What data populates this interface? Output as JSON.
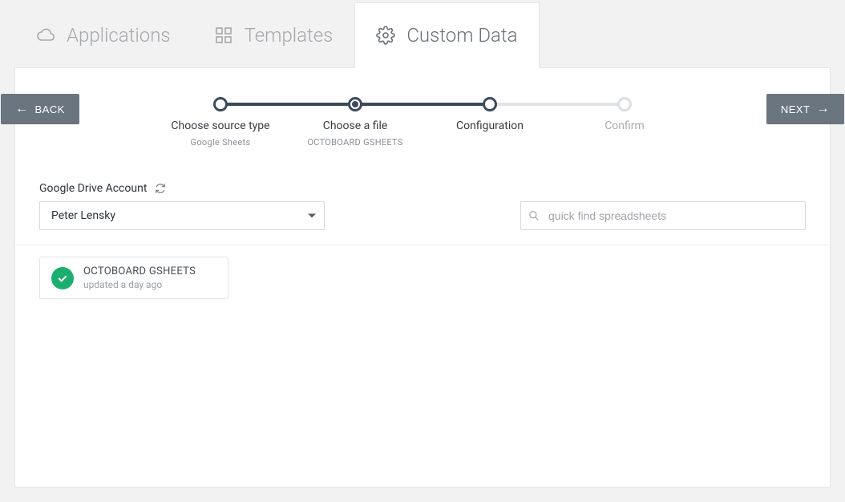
{
  "tabs": {
    "applications": "Applications",
    "templates": "Templates",
    "custom_data": "Custom Data"
  },
  "nav": {
    "back": "BACK",
    "next": "NEXT"
  },
  "stepper": {
    "steps": [
      {
        "title": "Choose source type",
        "sub": "Google Sheets"
      },
      {
        "title": "Choose a file",
        "sub": "OCTOBOARD GSHEETS"
      },
      {
        "title": "Configuration",
        "sub": ""
      },
      {
        "title": "Confirm",
        "sub": ""
      }
    ]
  },
  "account": {
    "label": "Google Drive Account",
    "selected": "Peter Lensky"
  },
  "search": {
    "placeholder": "quick find spreadsheets",
    "value": ""
  },
  "files": [
    {
      "title": "OCTOBOARD GSHEETS",
      "sub": "updated a day ago",
      "selected": true
    }
  ]
}
